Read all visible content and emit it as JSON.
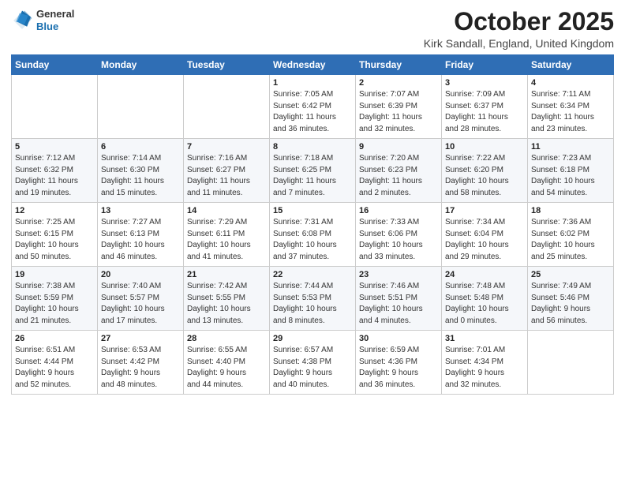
{
  "header": {
    "logo_line1": "General",
    "logo_line2": "Blue",
    "month": "October 2025",
    "location": "Kirk Sandall, England, United Kingdom"
  },
  "weekdays": [
    "Sunday",
    "Monday",
    "Tuesday",
    "Wednesday",
    "Thursday",
    "Friday",
    "Saturday"
  ],
  "rows": [
    [
      {
        "day": "",
        "detail": ""
      },
      {
        "day": "",
        "detail": ""
      },
      {
        "day": "",
        "detail": ""
      },
      {
        "day": "1",
        "detail": "Sunrise: 7:05 AM\nSunset: 6:42 PM\nDaylight: 11 hours\nand 36 minutes."
      },
      {
        "day": "2",
        "detail": "Sunrise: 7:07 AM\nSunset: 6:39 PM\nDaylight: 11 hours\nand 32 minutes."
      },
      {
        "day": "3",
        "detail": "Sunrise: 7:09 AM\nSunset: 6:37 PM\nDaylight: 11 hours\nand 28 minutes."
      },
      {
        "day": "4",
        "detail": "Sunrise: 7:11 AM\nSunset: 6:34 PM\nDaylight: 11 hours\nand 23 minutes."
      }
    ],
    [
      {
        "day": "5",
        "detail": "Sunrise: 7:12 AM\nSunset: 6:32 PM\nDaylight: 11 hours\nand 19 minutes."
      },
      {
        "day": "6",
        "detail": "Sunrise: 7:14 AM\nSunset: 6:30 PM\nDaylight: 11 hours\nand 15 minutes."
      },
      {
        "day": "7",
        "detail": "Sunrise: 7:16 AM\nSunset: 6:27 PM\nDaylight: 11 hours\nand 11 minutes."
      },
      {
        "day": "8",
        "detail": "Sunrise: 7:18 AM\nSunset: 6:25 PM\nDaylight: 11 hours\nand 7 minutes."
      },
      {
        "day": "9",
        "detail": "Sunrise: 7:20 AM\nSunset: 6:23 PM\nDaylight: 11 hours\nand 2 minutes."
      },
      {
        "day": "10",
        "detail": "Sunrise: 7:22 AM\nSunset: 6:20 PM\nDaylight: 10 hours\nand 58 minutes."
      },
      {
        "day": "11",
        "detail": "Sunrise: 7:23 AM\nSunset: 6:18 PM\nDaylight: 10 hours\nand 54 minutes."
      }
    ],
    [
      {
        "day": "12",
        "detail": "Sunrise: 7:25 AM\nSunset: 6:15 PM\nDaylight: 10 hours\nand 50 minutes."
      },
      {
        "day": "13",
        "detail": "Sunrise: 7:27 AM\nSunset: 6:13 PM\nDaylight: 10 hours\nand 46 minutes."
      },
      {
        "day": "14",
        "detail": "Sunrise: 7:29 AM\nSunset: 6:11 PM\nDaylight: 10 hours\nand 41 minutes."
      },
      {
        "day": "15",
        "detail": "Sunrise: 7:31 AM\nSunset: 6:08 PM\nDaylight: 10 hours\nand 37 minutes."
      },
      {
        "day": "16",
        "detail": "Sunrise: 7:33 AM\nSunset: 6:06 PM\nDaylight: 10 hours\nand 33 minutes."
      },
      {
        "day": "17",
        "detail": "Sunrise: 7:34 AM\nSunset: 6:04 PM\nDaylight: 10 hours\nand 29 minutes."
      },
      {
        "day": "18",
        "detail": "Sunrise: 7:36 AM\nSunset: 6:02 PM\nDaylight: 10 hours\nand 25 minutes."
      }
    ],
    [
      {
        "day": "19",
        "detail": "Sunrise: 7:38 AM\nSunset: 5:59 PM\nDaylight: 10 hours\nand 21 minutes."
      },
      {
        "day": "20",
        "detail": "Sunrise: 7:40 AM\nSunset: 5:57 PM\nDaylight: 10 hours\nand 17 minutes."
      },
      {
        "day": "21",
        "detail": "Sunrise: 7:42 AM\nSunset: 5:55 PM\nDaylight: 10 hours\nand 13 minutes."
      },
      {
        "day": "22",
        "detail": "Sunrise: 7:44 AM\nSunset: 5:53 PM\nDaylight: 10 hours\nand 8 minutes."
      },
      {
        "day": "23",
        "detail": "Sunrise: 7:46 AM\nSunset: 5:51 PM\nDaylight: 10 hours\nand 4 minutes."
      },
      {
        "day": "24",
        "detail": "Sunrise: 7:48 AM\nSunset: 5:48 PM\nDaylight: 10 hours\nand 0 minutes."
      },
      {
        "day": "25",
        "detail": "Sunrise: 7:49 AM\nSunset: 5:46 PM\nDaylight: 9 hours\nand 56 minutes."
      }
    ],
    [
      {
        "day": "26",
        "detail": "Sunrise: 6:51 AM\nSunset: 4:44 PM\nDaylight: 9 hours\nand 52 minutes."
      },
      {
        "day": "27",
        "detail": "Sunrise: 6:53 AM\nSunset: 4:42 PM\nDaylight: 9 hours\nand 48 minutes."
      },
      {
        "day": "28",
        "detail": "Sunrise: 6:55 AM\nSunset: 4:40 PM\nDaylight: 9 hours\nand 44 minutes."
      },
      {
        "day": "29",
        "detail": "Sunrise: 6:57 AM\nSunset: 4:38 PM\nDaylight: 9 hours\nand 40 minutes."
      },
      {
        "day": "30",
        "detail": "Sunrise: 6:59 AM\nSunset: 4:36 PM\nDaylight: 9 hours\nand 36 minutes."
      },
      {
        "day": "31",
        "detail": "Sunrise: 7:01 AM\nSunset: 4:34 PM\nDaylight: 9 hours\nand 32 minutes."
      },
      {
        "day": "",
        "detail": ""
      }
    ]
  ]
}
